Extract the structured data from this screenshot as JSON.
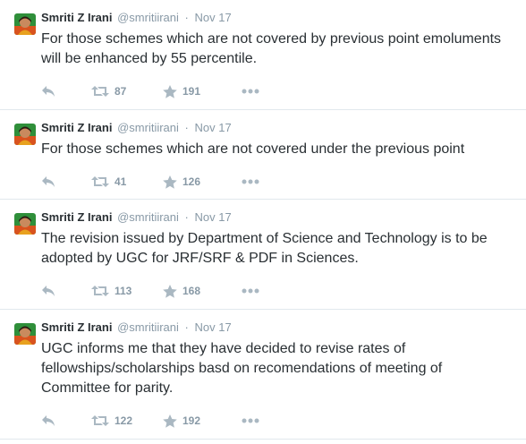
{
  "colors": {
    "border": "#e1e8ed",
    "meta": "#8899a6",
    "text": "#292f33",
    "icon": "#aab8c2"
  },
  "icons": {
    "avatar": "profile-photo",
    "reply": "reply-arrow-icon",
    "retweet": "retweet-icon",
    "favorite": "star-icon",
    "more": "ellipsis-icon"
  },
  "tweets": [
    {
      "name": "Smriti Z Irani",
      "handle": "@smritiirani",
      "sep": "·",
      "time": "Nov 17",
      "text": "For those schemes which are not covered by previous point emoluments will be enhanced by 55 percentile.",
      "retweets": "87",
      "favorites": "191"
    },
    {
      "name": "Smriti Z Irani",
      "handle": "@smritiirani",
      "sep": "·",
      "time": "Nov 17",
      "text": "For those schemes which are not covered under the previous point",
      "retweets": "41",
      "favorites": "126"
    },
    {
      "name": "Smriti Z Irani",
      "handle": "@smritiirani",
      "sep": "·",
      "time": "Nov 17",
      "text": "The revision issued by Department of Science and Technology is to be adopted by UGC for JRF/SRF & PDF in Sciences.",
      "retweets": "113",
      "favorites": "168"
    },
    {
      "name": "Smriti Z Irani",
      "handle": "@smritiirani",
      "sep": "·",
      "time": "Nov 17",
      "text": "UGC informs me that they have decided to revise rates of fellowships/scholarships basd on recomendations of meeting of Committee for parity.",
      "retweets": "122",
      "favorites": "192"
    }
  ]
}
